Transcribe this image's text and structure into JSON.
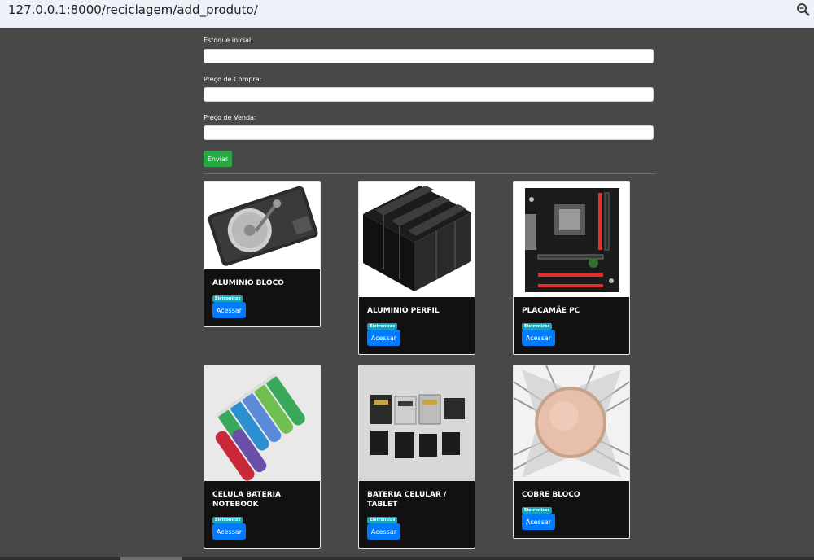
{
  "browser": {
    "url": "127.0.0.1:8000/reciclagem/add_produto/",
    "zoom_icon": "zoom-icon"
  },
  "form": {
    "stock_label": "Estoque inicial:",
    "stock_value": "",
    "buy_label": "Preço de Compra:",
    "buy_value": "",
    "sell_label": "Preço de Venda:",
    "sell_value": "",
    "submit_label": "Enviar"
  },
  "products": [
    {
      "title": "ALUMINIO BLOCO",
      "badge": "Eletronicos",
      "button": "Acessar",
      "image": "hard-drive"
    },
    {
      "title": "ALUMINIO PERFIL",
      "badge": "Eletronicos",
      "button": "Acessar",
      "image": "heatsink"
    },
    {
      "title": "PLACAMÃE PC",
      "badge": "Eletronicos",
      "button": "Acessar",
      "image": "motherboard"
    },
    {
      "title": "CELULA BATERIA NOTEBOOK",
      "badge": "Eletronicos",
      "button": "Acessar",
      "image": "battery-cells"
    },
    {
      "title": "BATERIA CELULAR / TABLET",
      "badge": "Eletronicos",
      "button": "Acessar",
      "image": "phone-batteries"
    },
    {
      "title": "COBRE BLOCO",
      "badge": "Eletronicos",
      "button": "Acessar",
      "image": "copper-cooler"
    }
  ],
  "colors": {
    "background": "#484848",
    "card": "#111111",
    "submit": "#28a745",
    "access": "#007bff",
    "badge": "#17a2b8"
  }
}
